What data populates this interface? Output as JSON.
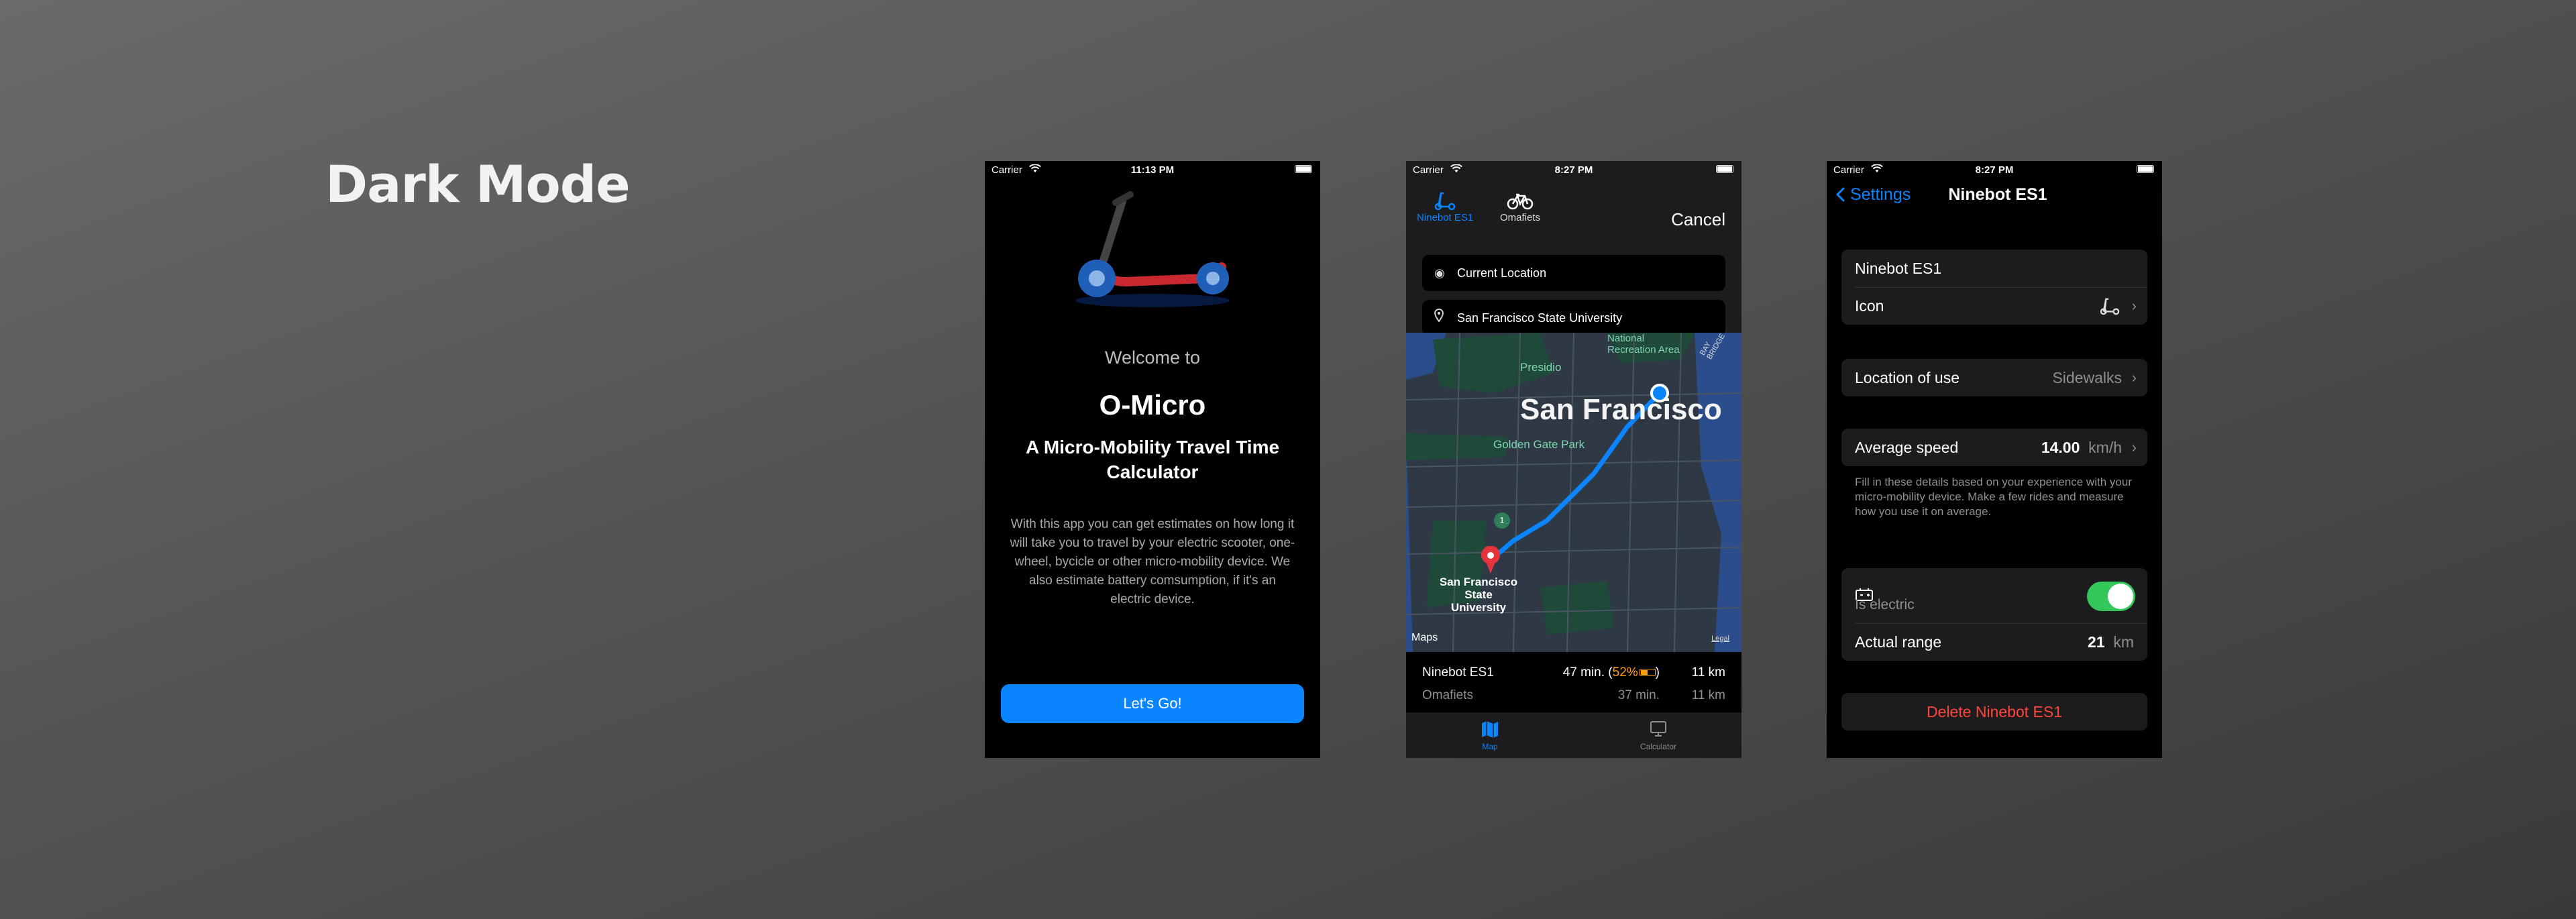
{
  "headline": "Dark Mode",
  "screen1": {
    "status": {
      "carrier": "Carrier",
      "time": "11:13 PM"
    },
    "welcome": "Welcome to",
    "title": "O-Micro",
    "subtitle": "A Micro-Mobility Travel Time Calculator",
    "body": "With this app you can get estimates on how long it will take you to travel by your electric scooter, one-wheel, bycicle or other micro-mobility device. We also estimate battery comsumption, if it's an electric device.",
    "button": "Let's Go!"
  },
  "screen2": {
    "status": {
      "carrier": "Carrier",
      "time": "8:27 PM"
    },
    "vehicles": [
      {
        "label": "Ninebot ES1",
        "icon": "scooter-icon",
        "selected": true
      },
      {
        "label": "Omafiets",
        "icon": "bicycle-icon",
        "selected": false
      }
    ],
    "cancel": "Cancel",
    "from": "Current Location",
    "to": "San Francisco State University",
    "map": {
      "city": "San Francisco",
      "labels": [
        "National Recreation Area",
        "Presidio",
        "Golden Gate Park",
        "San Francisco State University",
        "Maps",
        "Legal",
        "BAY BRIDGE"
      ],
      "route_badge": "1"
    },
    "results": [
      {
        "name": "Ninebot ES1",
        "time": "47 min.",
        "battery": "52%",
        "distance": "11 km"
      },
      {
        "name": "Omafiets",
        "time": "37 min.",
        "distance": "11 km"
      }
    ],
    "tabs": [
      {
        "label": "Map",
        "icon": "map-icon",
        "selected": true
      },
      {
        "label": "Calculator",
        "icon": "calculator-icon",
        "selected": false
      }
    ],
    "accent": "#0a84ff",
    "warning": "#ff9f0a"
  },
  "screen3": {
    "status": {
      "carrier": "Carrier",
      "time": "8:27 PM"
    },
    "back": "Settings",
    "title": "Ninebot ES1",
    "name_value": "Ninebot ES1",
    "icon_label": "Icon",
    "location_label": "Location of use",
    "location_value": "Sidewalks",
    "speed_label": "Average speed",
    "speed_value": "14.00",
    "speed_unit": "km/h",
    "footer": "Fill in these details based on your experience with your micro-mobility device. Make a few rides and measure how you use it on average.",
    "electric_label": "Is electric",
    "electric_on": true,
    "range_label": "Actual range",
    "range_value": "21",
    "range_unit": "km",
    "delete": "Delete Ninebot ES1",
    "toggle_color": "#34c759",
    "destructive": "#ff453a"
  }
}
